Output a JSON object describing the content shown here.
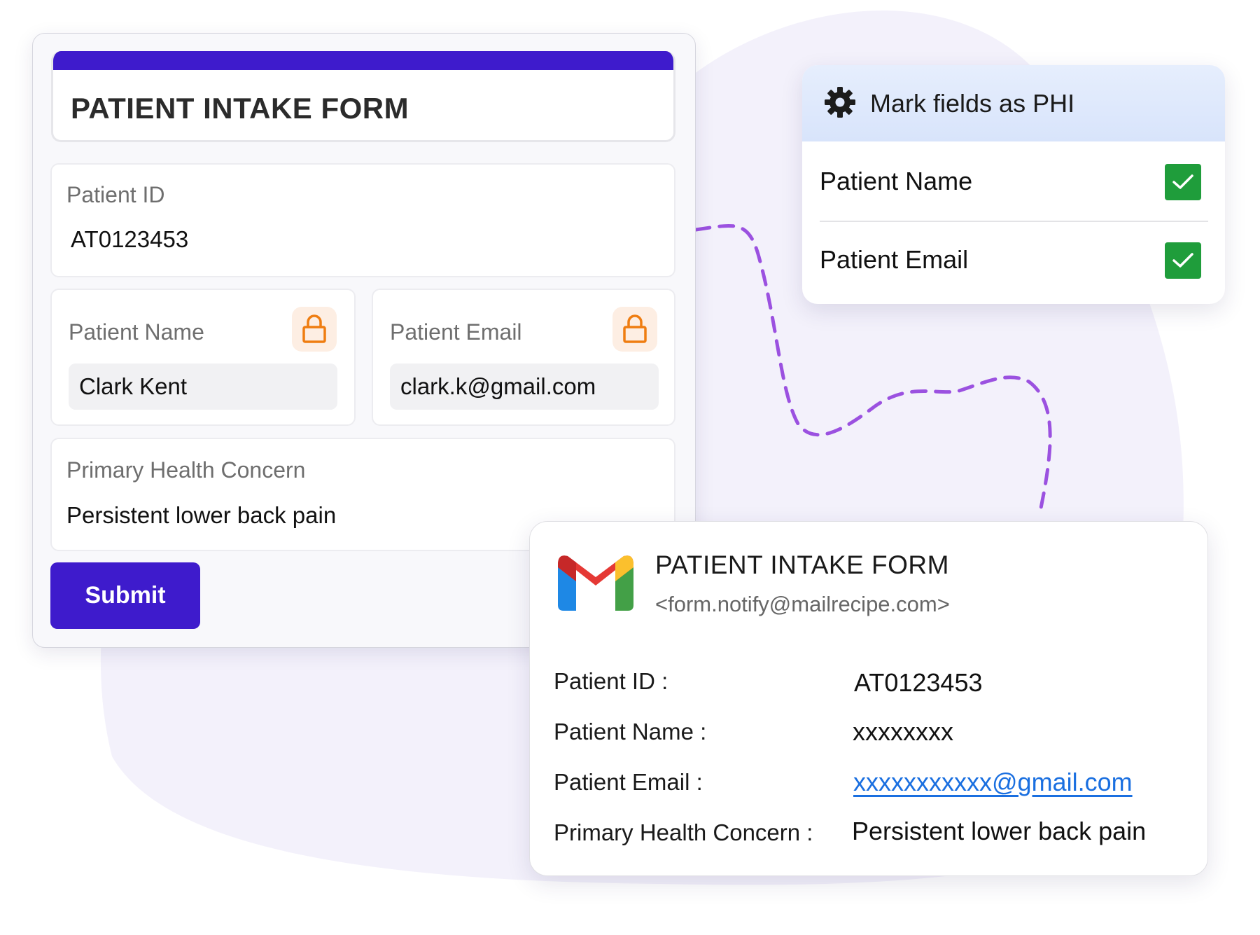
{
  "form": {
    "title": "PATIENT INTAKE FORM",
    "fields": {
      "patient_id": {
        "label": "Patient ID",
        "value": "AT0123453"
      },
      "patient_name": {
        "label": "Patient Name",
        "value": "Clark Kent",
        "icon": "lock-icon"
      },
      "patient_email": {
        "label": "Patient Email",
        "value": "clark.k@gmail.com",
        "icon": "lock-icon"
      },
      "primary_concern": {
        "label": "Primary Health Concern",
        "value": "Persistent lower back pain"
      }
    },
    "submit_label": "Submit"
  },
  "phi_panel": {
    "title": "Mark fields as PHI",
    "icon": "gear-icon",
    "items": [
      {
        "label": "Patient Name",
        "checked": true
      },
      {
        "label": "Patient Email",
        "checked": true
      }
    ]
  },
  "email": {
    "logo": "gmail-logo",
    "subject": "PATIENT INTAKE FORM",
    "sender": "<form.notify@mailrecipe.com>",
    "rows": [
      {
        "label": "Patient ID :",
        "value": "AT0123453"
      },
      {
        "label": "Patient Name :",
        "value": "xxxxxxxx"
      },
      {
        "label": "Patient Email :",
        "value": "xxxxxxxxxxx@gmail.com"
      },
      {
        "label": "Primary Health Concern :",
        "value": "Persistent lower back pain"
      }
    ]
  },
  "colors": {
    "brand": "#3e1bcc",
    "lock_bg": "#fdeee3",
    "lock": "#ef7d11",
    "check": "#1f9d3b",
    "link": "#1a6fe0",
    "connector": "#9b51e0",
    "blob": "#f3f1fb"
  }
}
